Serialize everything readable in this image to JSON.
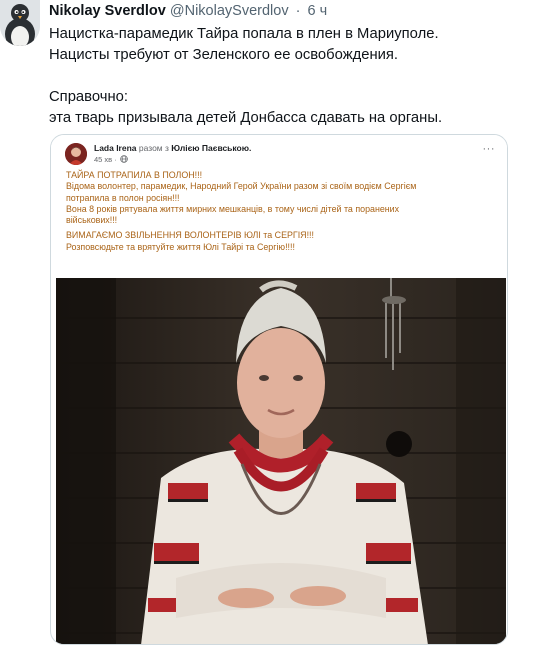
{
  "tweet": {
    "author_name": "Nikolay Sverdlov",
    "handle": "@NikolaySverdlov",
    "separator": "·",
    "time": "6 ч",
    "lines": [
      "Нацистка-парамедик Тайра попала в плен в Мариуполе.",
      "Нацисты требуют от Зеленского ее освобождения.",
      "",
      "Справочно:",
      "эта тварь призывала детей Донбасса сдавать на органы."
    ]
  },
  "facebook_post": {
    "author": "Lada Irena",
    "with_prefix": "разом з",
    "with_name": "Юлією Паєвською.",
    "time": "45 хв ·",
    "more_label": "···",
    "lines": [
      "ТАЙРА   ПОТРАПИЛА В ПОЛОН!!!",
      "Відома волонтер, парамедик, Народний Герой України разом зі своїм водієм Сергієм",
      "потрапила в полон росіян!!!",
      "Вона 8 років рятувала життя мирних мешканців, в тому числі дітей та поранених",
      "військових!!!",
      "",
      "ВИМАГАЄМО ЗВІЛЬНЕННЯ ВОЛОНТЕРІВ ЮЛІ та СЕРГІЯ!!!",
      "Розповсюдьте та врятуйте життя Юлі Тайрі та Сергію!!!!"
    ]
  },
  "icons": {
    "tweet_avatar": "penguin-avatar-icon",
    "fb_avatar": "profile-avatar-icon",
    "globe": "globe-icon",
    "more": "more-options-icon"
  },
  "colors": {
    "text": "#0f1419",
    "muted": "#536471",
    "border": "#cfd9de",
    "fb_text": "#aa6418"
  }
}
